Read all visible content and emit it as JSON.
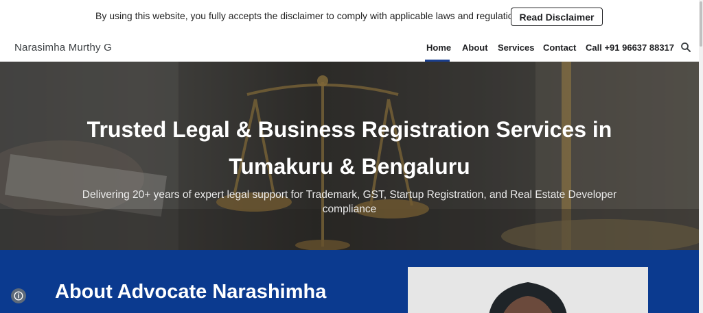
{
  "disclaimer": {
    "text": "By using this website, you fully accepts the disclaimer to comply with applicable laws and regulations.",
    "button_label": "Read Disclaimer"
  },
  "header": {
    "site_title": "Narasimha Murthy G",
    "nav": [
      {
        "label": "Home",
        "active": true
      },
      {
        "label": "About",
        "active": false
      },
      {
        "label": "Services",
        "active": false
      },
      {
        "label": "Contact",
        "active": false
      },
      {
        "label": "Call +91 96637 88317",
        "active": false
      }
    ],
    "search_icon": "search-icon",
    "active_color": "#1a3f8f"
  },
  "hero": {
    "title_line1": "Trusted Legal & Business Registration Services in",
    "title_line2": "Tumakuru & Bengaluru",
    "subtitle_line1": "Delivering 20+ years of expert legal support for Trademark, GST, Startup Registration, and Real Estate Developer",
    "subtitle_line2": "compliance"
  },
  "about": {
    "heading": "About Advocate Narashimha",
    "background_color": "#0b3a8f"
  },
  "badge": {
    "icon": "info-icon"
  }
}
